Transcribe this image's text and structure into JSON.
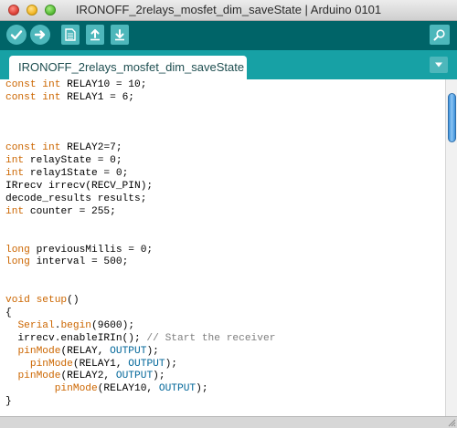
{
  "window": {
    "title": "IRONOFF_2relays_mosfet_dim_saveState | Arduino 0101"
  },
  "toolbar": {
    "buttons": [
      {
        "icon": "verify-icon"
      },
      {
        "icon": "upload-icon"
      },
      {
        "icon": "new-file-icon"
      },
      {
        "icon": "open-icon"
      },
      {
        "icon": "save-icon"
      }
    ],
    "serial_icon": "serial-monitor-icon"
  },
  "tabs": [
    {
      "label": "IRONOFF_2relays_mosfet_dim_saveState §"
    }
  ],
  "colors": {
    "toolbar": "#006468",
    "tabstrip": "#17a1a5",
    "button": "#4db7bb",
    "keyword": "#cc6600",
    "constant": "#006699",
    "comment": "#7e7e7e"
  },
  "code": [
    [
      {
        "t": "kw",
        "s": "const"
      },
      {
        "t": "",
        "s": " "
      },
      {
        "t": "kw",
        "s": "int"
      },
      {
        "t": "",
        "s": " RELAY10 = 10;"
      }
    ],
    [
      {
        "t": "kw",
        "s": "const"
      },
      {
        "t": "",
        "s": " "
      },
      {
        "t": "kw",
        "s": "int"
      },
      {
        "t": "",
        "s": " RELAY1 = 6;"
      }
    ],
    [],
    [],
    [],
    [
      {
        "t": "kw",
        "s": "const"
      },
      {
        "t": "",
        "s": " "
      },
      {
        "t": "kw",
        "s": "int"
      },
      {
        "t": "",
        "s": " RELAY2=7;"
      }
    ],
    [
      {
        "t": "kw",
        "s": "int"
      },
      {
        "t": "",
        "s": " relayState = 0;"
      }
    ],
    [
      {
        "t": "kw",
        "s": "int"
      },
      {
        "t": "",
        "s": " relay1State = 0;"
      }
    ],
    [
      {
        "t": "",
        "s": "IRrecv irrecv(RECV_PIN);"
      }
    ],
    [
      {
        "t": "",
        "s": "decode_results results;"
      }
    ],
    [
      {
        "t": "kw",
        "s": "int"
      },
      {
        "t": "",
        "s": " counter = 255;"
      }
    ],
    [],
    [],
    [
      {
        "t": "kw",
        "s": "long"
      },
      {
        "t": "",
        "s": " previousMillis = 0;"
      }
    ],
    [
      {
        "t": "kw",
        "s": "long"
      },
      {
        "t": "",
        "s": " interval = 500;"
      }
    ],
    [],
    [],
    [
      {
        "t": "kw",
        "s": "void"
      },
      {
        "t": "",
        "s": " "
      },
      {
        "t": "fn",
        "s": "setup"
      },
      {
        "t": "",
        "s": "()"
      }
    ],
    [
      {
        "t": "",
        "s": "{"
      }
    ],
    [
      {
        "t": "",
        "s": "  "
      },
      {
        "t": "fn",
        "s": "Serial"
      },
      {
        "t": "",
        "s": "."
      },
      {
        "t": "fn",
        "s": "begin"
      },
      {
        "t": "",
        "s": "(9600);"
      }
    ],
    [
      {
        "t": "",
        "s": "  irrecv.enableIRIn(); "
      },
      {
        "t": "cm",
        "s": "// Start the receiver"
      }
    ],
    [
      {
        "t": "",
        "s": "  "
      },
      {
        "t": "fn",
        "s": "pinMode"
      },
      {
        "t": "",
        "s": "(RELAY, "
      },
      {
        "t": "cn",
        "s": "OUTPUT"
      },
      {
        "t": "",
        "s": ");"
      }
    ],
    [
      {
        "t": "",
        "s": "    "
      },
      {
        "t": "fn",
        "s": "pinMode"
      },
      {
        "t": "",
        "s": "(RELAY1, "
      },
      {
        "t": "cn",
        "s": "OUTPUT"
      },
      {
        "t": "",
        "s": ");"
      }
    ],
    [
      {
        "t": "",
        "s": "  "
      },
      {
        "t": "fn",
        "s": "pinMode"
      },
      {
        "t": "",
        "s": "(RELAY2, "
      },
      {
        "t": "cn",
        "s": "OUTPUT"
      },
      {
        "t": "",
        "s": ");"
      }
    ],
    [
      {
        "t": "",
        "s": "        "
      },
      {
        "t": "fn",
        "s": "pinMode"
      },
      {
        "t": "",
        "s": "(RELAY10, "
      },
      {
        "t": "cn",
        "s": "OUTPUT"
      },
      {
        "t": "",
        "s": ");"
      }
    ],
    [
      {
        "t": "",
        "s": "}"
      }
    ]
  ]
}
